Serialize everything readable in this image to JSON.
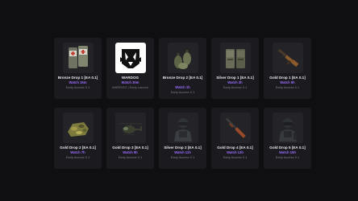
{
  "drops": [
    {
      "title": "Bronze Drop 1 [EA 0.1]",
      "watch": "Watch 15m",
      "sub": "Early Access 0.1",
      "icon": "medkit-icon"
    },
    {
      "title": "WARDOG",
      "watch": "Watch 30m",
      "sub": "WARDOG | Early Launch",
      "icon": "wolf-logo-icon"
    },
    {
      "title": "Bronze Drop 2 [EA 0.1]",
      "watch": "Watch 1h",
      "sub": "Early Access 0.1",
      "icon": "grenades-icon"
    },
    {
      "title": "Silver Drop 1 [EA 0.1]",
      "watch": "Watch 2h",
      "sub": "Early Access 0.1",
      "icon": "ammo-pouch-icon"
    },
    {
      "title": "Gold Drop 1 [EA 0.1]",
      "watch": "Watch 5h",
      "sub": "Early Access 0.1",
      "icon": "rifle-icon"
    },
    {
      "title": "Gold Drop 2 [EA 0.1]",
      "watch": "Watch 7h",
      "sub": "Early Access 0.1",
      "icon": "camo-vehicle-icon"
    },
    {
      "title": "Gold Drop 3 [EA 0.1]",
      "watch": "Watch 9h",
      "sub": "Early Access 0.1",
      "icon": "helicopter-icon"
    },
    {
      "title": "Silver Drop 2 [EA 0.1]",
      "watch": "Watch 11h",
      "sub": "Early Access 0.1",
      "icon": "soldier-icon"
    },
    {
      "title": "Gold Drop 4 [EA 0.1]",
      "watch": "Watch 13h",
      "sub": "Early Access 0.1",
      "icon": "shotgun-icon"
    },
    {
      "title": "Gold Drop 5 [EA 0.1]",
      "watch": "Watch 15h",
      "sub": "Early Access 0.1",
      "icon": "soldier-icon"
    }
  ],
  "colors": {
    "background": "#0f0f12",
    "card": "#1b1b1f",
    "accent": "#9b6cff",
    "muted": "#7d7d86"
  }
}
